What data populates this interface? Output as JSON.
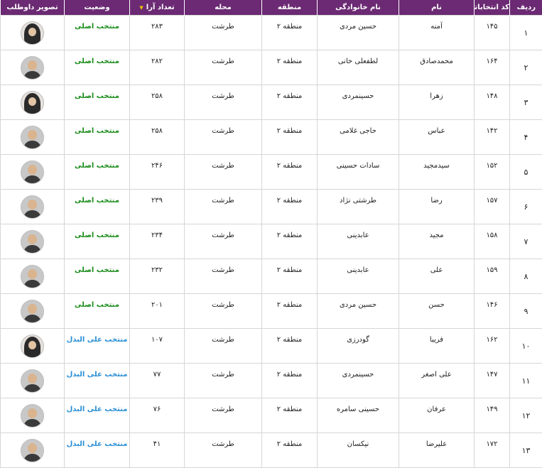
{
  "header": {
    "row_label": "ردیف",
    "code_label": "کد انتخاباتی",
    "first_name_label": "نام",
    "last_name_label": "نام خانوادگی",
    "region_label": "منطقه",
    "district_label": "محله",
    "votes_label": "تعداد آرا",
    "status_label": "وضعیت",
    "photo_label": "تصویر داوطلب",
    "sort_icon": "sort-down-arrow"
  },
  "colors": {
    "header_bg": "#6b2a73",
    "status_main": "#1a8c1a",
    "status_alternate": "#2a8fd6"
  },
  "rows": [
    {
      "num": "۱",
      "code": "۱۴۵",
      "first": "آمنه",
      "last": "حسین مردی",
      "region": "منطقه ۲",
      "district": "طرشت",
      "votes": "۲۸۳",
      "status": "منتخب اصلی",
      "status_type": "main",
      "photo": "female"
    },
    {
      "num": "۲",
      "code": "۱۶۴",
      "first": "محمدصادق",
      "last": "لطفعلی خانی",
      "region": "منطقه ۲",
      "district": "طرشت",
      "votes": "۲۸۲",
      "status": "منتخب اصلی",
      "status_type": "main",
      "photo": "male"
    },
    {
      "num": "۳",
      "code": "۱۴۸",
      "first": "زهرا",
      "last": "حسینمردی",
      "region": "منطقه ۲",
      "district": "طرشت",
      "votes": "۲۵۸",
      "status": "منتخب اصلی",
      "status_type": "main",
      "photo": "female"
    },
    {
      "num": "۴",
      "code": "۱۴۲",
      "first": "عباس",
      "last": "حاجی غلامی",
      "region": "منطقه ۲",
      "district": "طرشت",
      "votes": "۲۵۸",
      "status": "منتخب اصلی",
      "status_type": "main",
      "photo": "male"
    },
    {
      "num": "۵",
      "code": "۱۵۲",
      "first": "سیدمجید",
      "last": "سادات حسینی",
      "region": "منطقه ۲",
      "district": "طرشت",
      "votes": "۲۴۶",
      "status": "منتخب اصلی",
      "status_type": "main",
      "photo": "male"
    },
    {
      "num": "۶",
      "code": "۱۵۷",
      "first": "رضا",
      "last": "طرشتی نژاد",
      "region": "منطقه ۲",
      "district": "طرشت",
      "votes": "۲۳۹",
      "status": "منتخب اصلی",
      "status_type": "main",
      "photo": "male"
    },
    {
      "num": "۷",
      "code": "۱۵۸",
      "first": "مجید",
      "last": "عابدینی",
      "region": "منطقه ۲",
      "district": "طرشت",
      "votes": "۲۳۴",
      "status": "منتخب اصلی",
      "status_type": "main",
      "photo": "male"
    },
    {
      "num": "۸",
      "code": "۱۵۹",
      "first": "علی",
      "last": "عابدینی",
      "region": "منطقه ۲",
      "district": "طرشت",
      "votes": "۲۳۲",
      "status": "منتخب اصلی",
      "status_type": "main",
      "photo": "male"
    },
    {
      "num": "۹",
      "code": "۱۴۶",
      "first": "حسن",
      "last": "حسین مردی",
      "region": "منطقه ۲",
      "district": "طرشت",
      "votes": "۲۰۱",
      "status": "منتخب اصلی",
      "status_type": "main",
      "photo": "male"
    },
    {
      "num": "۱۰",
      "code": "۱۶۲",
      "first": "فریبا",
      "last": "گودرزی",
      "region": "منطقه ۲",
      "district": "طرشت",
      "votes": "۱۰۷",
      "status": "منتخب علی البدل",
      "status_type": "alternate",
      "photo": "female"
    },
    {
      "num": "۱۱",
      "code": "۱۴۷",
      "first": "علی اصغر",
      "last": "حسینمردی",
      "region": "منطقه ۲",
      "district": "طرشت",
      "votes": "۷۷",
      "status": "منتخب علی البدل",
      "status_type": "alternate",
      "photo": "male"
    },
    {
      "num": "۱۲",
      "code": "۱۴۹",
      "first": "عرفان",
      "last": "حسینی سامره",
      "region": "منطقه ۲",
      "district": "طرشت",
      "votes": "۷۶",
      "status": "منتخب علی البدل",
      "status_type": "alternate",
      "photo": "male"
    },
    {
      "num": "۱۳",
      "code": "۱۷۲",
      "first": "علیرضا",
      "last": "نیکسان",
      "region": "منطقه ۲",
      "district": "طرشت",
      "votes": "۴۱",
      "status": "منتخب علی البدل",
      "status_type": "alternate",
      "photo": "male"
    }
  ]
}
